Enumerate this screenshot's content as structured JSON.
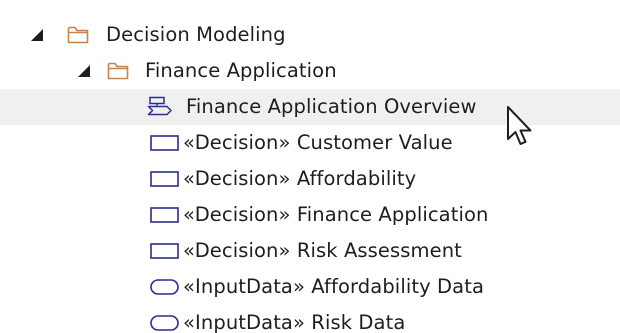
{
  "tree": {
    "root": {
      "label": "Decision Modeling",
      "expanded": true,
      "icon": "folder-icon",
      "children": {
        "package": {
          "label": "Finance Application",
          "expanded": true,
          "icon": "folder-icon",
          "items": [
            {
              "label": "Finance Application Overview",
              "icon": "diagram-icon",
              "selected": true
            },
            {
              "label": "«Decision» Customer Value",
              "icon": "decision-icon"
            },
            {
              "label": "«Decision» Affordability",
              "icon": "decision-icon"
            },
            {
              "label": "«Decision» Finance Application",
              "icon": "decision-icon"
            },
            {
              "label": "«Decision» Risk Assessment",
              "icon": "decision-icon"
            },
            {
              "label": "«InputData» Affordability Data",
              "icon": "input-data-icon"
            },
            {
              "label": "«InputData» Risk Data",
              "icon": "input-data-icon"
            }
          ]
        }
      }
    }
  },
  "colors": {
    "folder": "#c8844a",
    "element_outline": "#2a2f8c",
    "selected_row": "#f0f0f0",
    "text": "#1e1e1e"
  }
}
